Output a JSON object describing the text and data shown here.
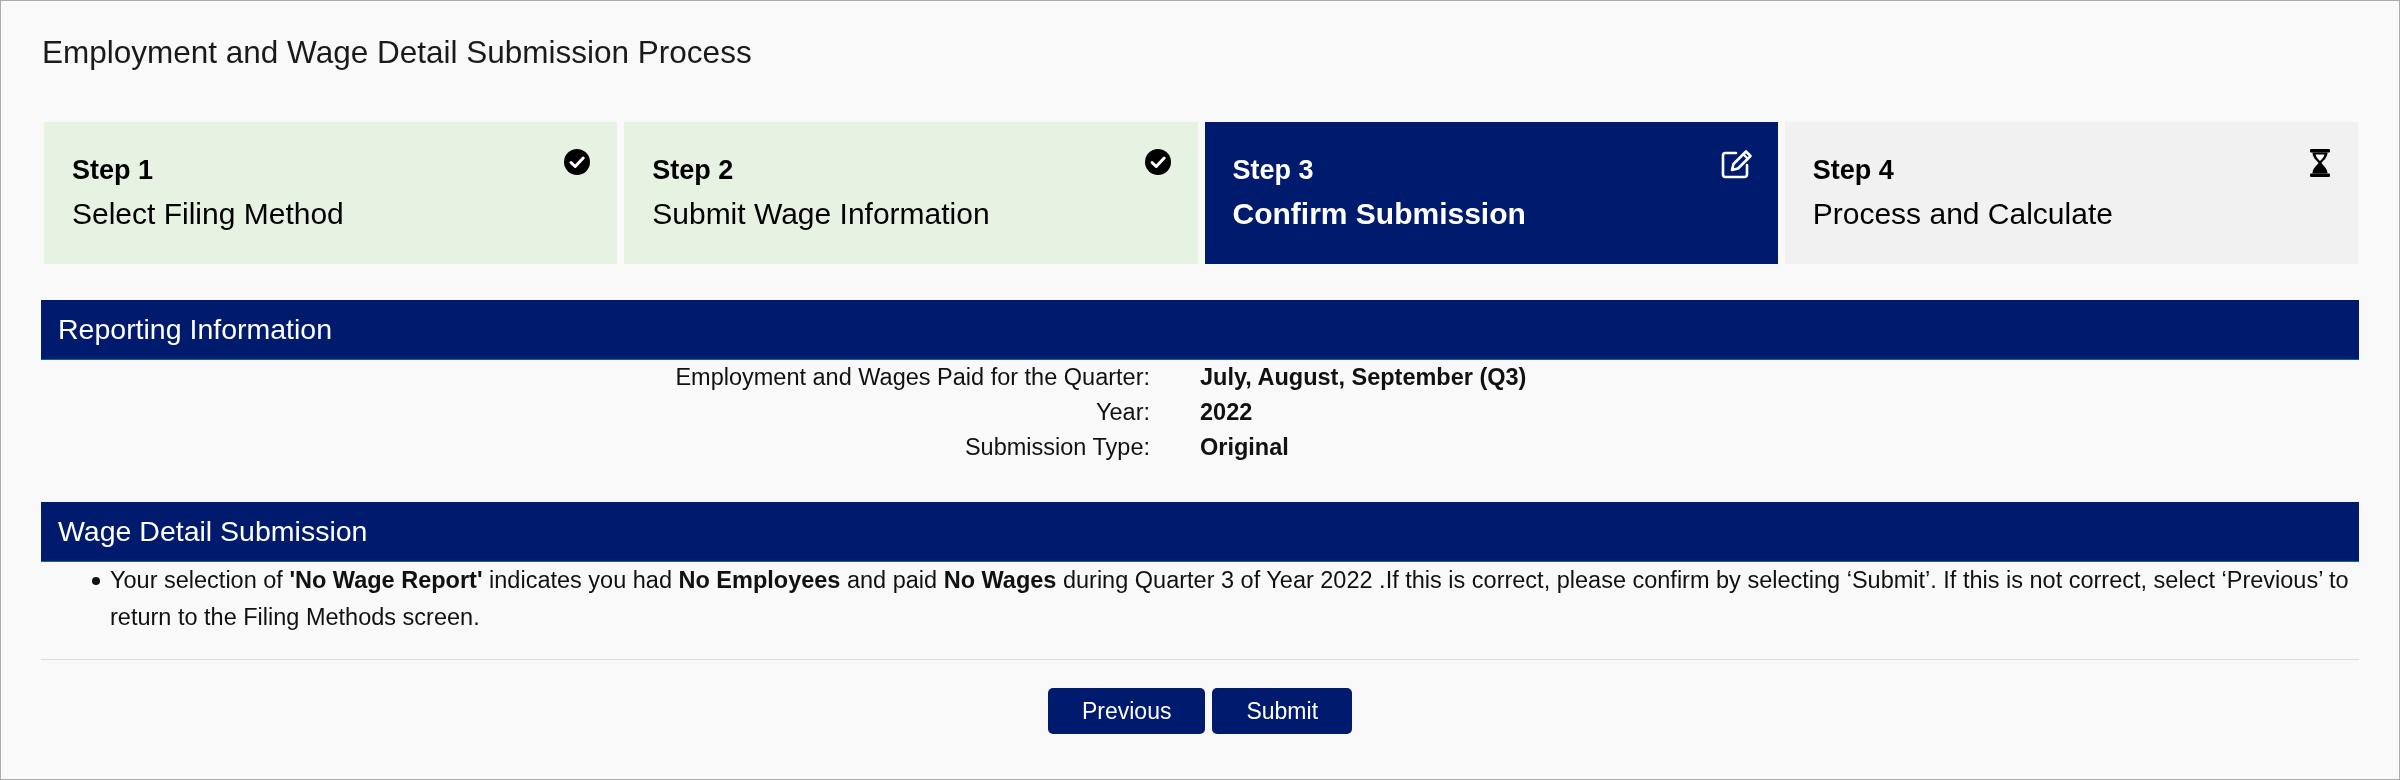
{
  "page": {
    "title": "Employment and Wage Detail Submission Process"
  },
  "steps": [
    {
      "number": "Step 1",
      "label": "Select Filing Method",
      "completed": true,
      "selected": false
    },
    {
      "number": "Step 2",
      "label": "Submit Wage Information",
      "completed": true,
      "selected": false
    },
    {
      "number": "Step 3",
      "label": "Confirm Submission",
      "completed": false,
      "selected": true
    },
    {
      "number": "Step 4",
      "label": "Process and Calculate",
      "completed": false,
      "selected": false
    }
  ],
  "reporting_information": {
    "title": "Reporting Information",
    "fields": [
      {
        "label": "Employment and Wages Paid for the Quarter:",
        "value": "July, August, September (Q3)"
      },
      {
        "label": "Year:",
        "value": "2022"
      },
      {
        "label": "Submission Type:",
        "value": "Original"
      }
    ]
  },
  "wage_detail_submission": {
    "title": "Wage Detail Submission",
    "items": [
      "Your selection of **'No Wage Report'** indicates you had **No Employees** and paid **No Wages** during Quarter 3 of Year 2022 .If this is correct, please confirm by selecting ‘Submit’. If this is not correct, select ‘Previous’ to return to the Filing Methods screen."
    ]
  },
  "buttons": [
    {
      "label": "Previous"
    },
    {
      "label": "Submit"
    }
  ]
}
